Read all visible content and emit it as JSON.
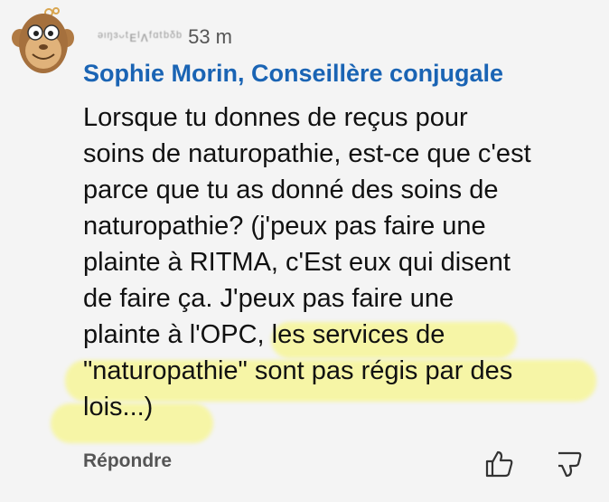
{
  "comment": {
    "meta_blurred": "ᵊᶦᵑᶟᵕᵗᴇᴵᴧᶠᵅᵗᵇᵟᵇ",
    "time": "53 m",
    "author": "Sophie Morin, Conseillère conjugale",
    "lines": [
      "Lorsque tu donnes de reçus pour",
      "soins de naturopathie, est-ce que c'est",
      "parce que tu as donné des soins de",
      "naturopathie? (j'peux pas faire une",
      "plainte à RITMA, c'Est eux qui disent",
      "de faire ça. J'peux pas faire une",
      "plainte à l'OPC, les services de",
      "\"naturopathie\" sont pas régis par des",
      "lois...)"
    ],
    "reply_label": "Répondre",
    "highlight_color": "#f7f68c"
  },
  "icons": {
    "avatar": "monkey-avatar-icon",
    "like": "thumbs-up-icon",
    "dislike": "thumbs-down-icon"
  }
}
